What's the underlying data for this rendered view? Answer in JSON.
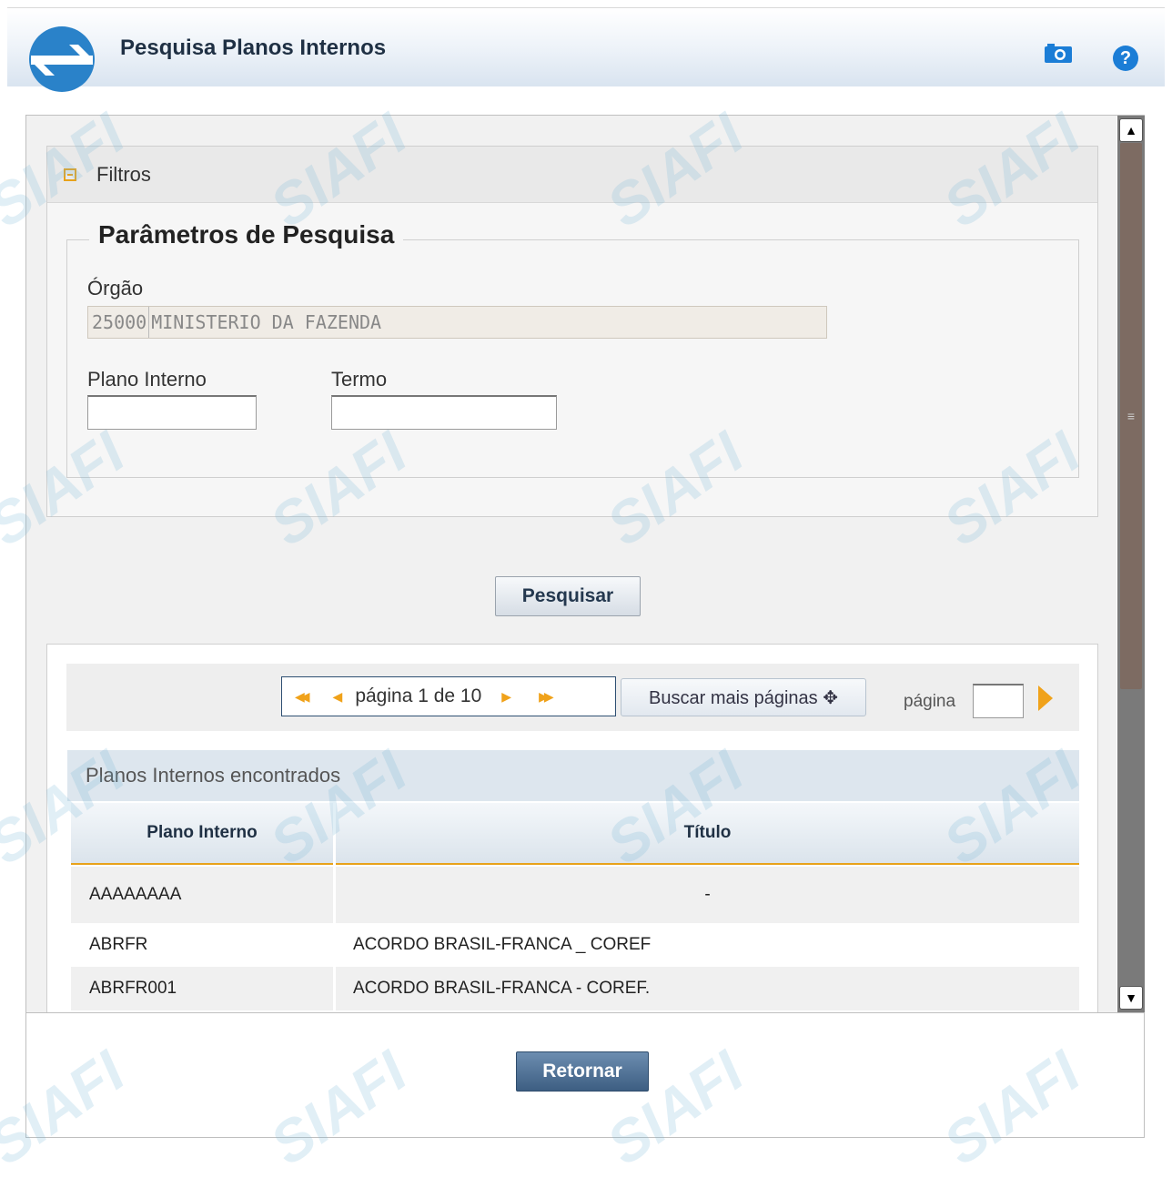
{
  "header": {
    "title": "Pesquisa Planos Internos"
  },
  "icons": {
    "camera": "camera-icon",
    "help": "help-icon",
    "help_glyph": "?"
  },
  "filtros": {
    "label": "Filtros",
    "legend": "Parâmetros de Pesquisa",
    "orgao_label": "Órgão",
    "orgao_code": "25000",
    "orgao_name": "MINISTERIO DA FAZENDA",
    "plano_interno_label": "Plano Interno",
    "plano_interno_value": "",
    "termo_label": "Termo",
    "termo_value": ""
  },
  "actions": {
    "pesquisar": "Pesquisar",
    "retornar": "Retornar"
  },
  "pager": {
    "text": "página 1 de 10",
    "buscar_mais": "Buscar mais páginas ✥",
    "pagina_label": "página",
    "pagina_value": ""
  },
  "results": {
    "title": "Planos Internos encontrados",
    "columns": [
      "Plano Interno",
      "Título"
    ],
    "rows": [
      {
        "plano": "AAAAAAAA",
        "titulo": "-"
      },
      {
        "plano": "ABRFR",
        "titulo": "ACORDO BRASIL-FRANCA _ COREF"
      },
      {
        "plano": "ABRFR001",
        "titulo": "ACORDO BRASIL-FRANCA - COREF."
      }
    ]
  },
  "colors": {
    "accent": "#e8a21a",
    "primary_dark": "#1f3044",
    "button_blue": "#3d5e82"
  }
}
